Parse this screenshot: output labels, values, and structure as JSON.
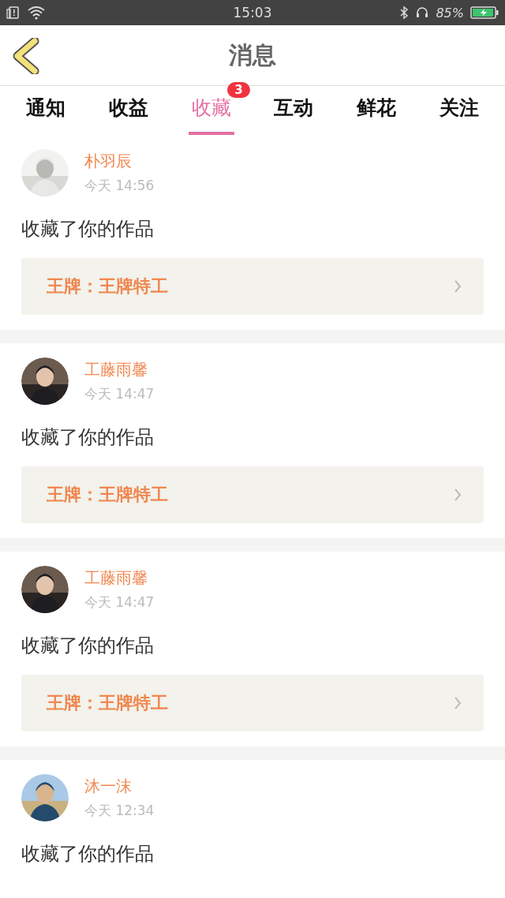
{
  "status_bar": {
    "time": "15:03",
    "battery": "85%"
  },
  "header": {
    "title": "消息"
  },
  "tabs": [
    {
      "label": "通知",
      "selected": false
    },
    {
      "label": "收益",
      "selected": false
    },
    {
      "label": "收藏",
      "selected": true,
      "badge": "3"
    },
    {
      "label": "互动",
      "selected": false
    },
    {
      "label": "鲜花",
      "selected": false
    },
    {
      "label": "关注",
      "selected": false
    }
  ],
  "messages": [
    {
      "user": "朴羽辰",
      "time": "今天 14:56",
      "text": "收藏了你的作品",
      "work": "王牌：王牌特工"
    },
    {
      "user": "工藤雨馨",
      "time": "今天 14:47",
      "text": "收藏了你的作品",
      "work": "王牌：王牌特工"
    },
    {
      "user": "工藤雨馨",
      "time": "今天 14:47",
      "text": "收藏了你的作品",
      "work": "王牌：王牌特工"
    },
    {
      "user": "沐一沫",
      "time": "今天 12:34",
      "text": "收藏了你的作品"
    }
  ]
}
